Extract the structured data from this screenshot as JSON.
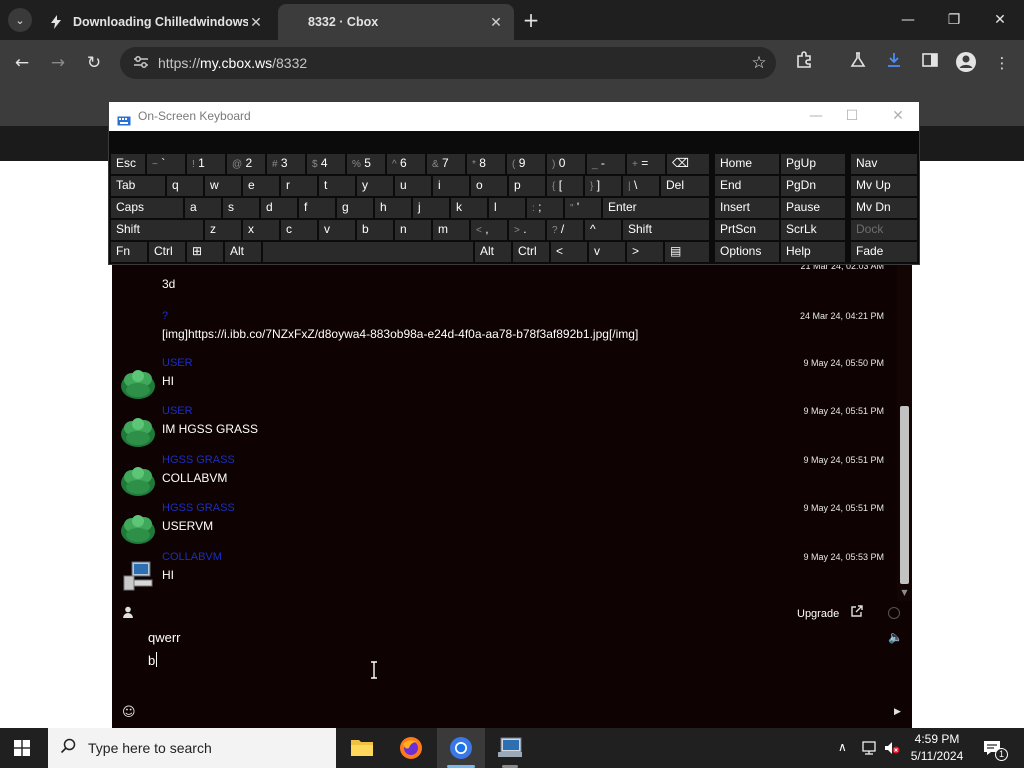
{
  "browser": {
    "tabs": [
      {
        "title": "Downloading Chilledwindows.zip",
        "active": false
      },
      {
        "title": "8332 · Cbox",
        "active": true
      }
    ],
    "url_prefix": "https://",
    "url_host": "my.cbox.ws",
    "url_path": "/8332",
    "colors": {
      "chrome": "#3c3c3c",
      "tabbar": "#1f1f1f",
      "download_active": "#4c8df6"
    }
  },
  "osk": {
    "title": "On-Screen Keyboard",
    "rows": [
      [
        {
          "s": "",
          "m": "Esc"
        },
        {
          "s": "~",
          "m": "`"
        },
        {
          "s": "!",
          "m": "1"
        },
        {
          "s": "@",
          "m": "2"
        },
        {
          "s": "#",
          "m": "3"
        },
        {
          "s": "$",
          "m": "4"
        },
        {
          "s": "%",
          "m": "5"
        },
        {
          "s": "^",
          "m": "6"
        },
        {
          "s": "&",
          "m": "7"
        },
        {
          "s": "*",
          "m": "8"
        },
        {
          "s": "(",
          "m": "9"
        },
        {
          "s": ")",
          "m": "0"
        },
        {
          "s": "_",
          "m": "-"
        },
        {
          "s": "+",
          "m": "="
        },
        {
          "s": "",
          "m": "⌫"
        }
      ],
      [
        {
          "s": "",
          "m": "Tab"
        },
        {
          "s": "",
          "m": "q"
        },
        {
          "s": "",
          "m": "w"
        },
        {
          "s": "",
          "m": "e"
        },
        {
          "s": "",
          "m": "r"
        },
        {
          "s": "",
          "m": "t"
        },
        {
          "s": "",
          "m": "y"
        },
        {
          "s": "",
          "m": "u"
        },
        {
          "s": "",
          "m": "i"
        },
        {
          "s": "",
          "m": "o"
        },
        {
          "s": "",
          "m": "p"
        },
        {
          "s": "{",
          "m": "["
        },
        {
          "s": "}",
          "m": "]"
        },
        {
          "s": "|",
          "m": "\\"
        },
        {
          "s": "",
          "m": "Del"
        }
      ],
      [
        {
          "s": "",
          "m": "Caps"
        },
        {
          "s": "",
          "m": "a"
        },
        {
          "s": "",
          "m": "s"
        },
        {
          "s": "",
          "m": "d"
        },
        {
          "s": "",
          "m": "f"
        },
        {
          "s": "",
          "m": "g"
        },
        {
          "s": "",
          "m": "h"
        },
        {
          "s": "",
          "m": "j"
        },
        {
          "s": "",
          "m": "k"
        },
        {
          "s": "",
          "m": "l"
        },
        {
          "s": ":",
          "m": ";"
        },
        {
          "s": "\"",
          "m": "'"
        },
        {
          "s": "",
          "m": "Enter"
        }
      ],
      [
        {
          "s": "",
          "m": "Shift"
        },
        {
          "s": "",
          "m": "z"
        },
        {
          "s": "",
          "m": "x"
        },
        {
          "s": "",
          "m": "c"
        },
        {
          "s": "",
          "m": "v"
        },
        {
          "s": "",
          "m": "b"
        },
        {
          "s": "",
          "m": "n"
        },
        {
          "s": "",
          "m": "m"
        },
        {
          "s": "<",
          "m": ","
        },
        {
          "s": ">",
          "m": "."
        },
        {
          "s": "?",
          "m": "/"
        },
        {
          "s": "",
          "m": "^"
        },
        {
          "s": "",
          "m": "Shift"
        }
      ],
      [
        {
          "s": "",
          "m": "Fn"
        },
        {
          "s": "",
          "m": "Ctrl"
        },
        {
          "s": "",
          "m": "⊞"
        },
        {
          "s": "",
          "m": "Alt"
        },
        {
          "s": "",
          "m": ""
        },
        {
          "s": "",
          "m": "Alt"
        },
        {
          "s": "",
          "m": "Ctrl"
        },
        {
          "s": "",
          "m": "<"
        },
        {
          "s": "",
          "m": "v"
        },
        {
          "s": "",
          "m": ">"
        },
        {
          "s": "",
          "m": "▤"
        }
      ]
    ],
    "nav_keys": [
      [
        "Home",
        "PgUp",
        "Nav"
      ],
      [
        "End",
        "PgDn",
        "Mv Up"
      ],
      [
        "Insert",
        "Pause",
        "Mv Dn"
      ],
      [
        "PrtScn",
        "ScrLk",
        "Dock"
      ],
      [
        "Options",
        "Help",
        "Fade"
      ]
    ]
  },
  "chat": {
    "messages": [
      {
        "user": "",
        "text": "3d",
        "time": "21 Mar 24, 02:03 AM",
        "avatar": "none"
      },
      {
        "user": "?",
        "text": "[img]https://i.ibb.co/7NZxFxZ/d8oywa4-883ob98a-e24d-4f0a-aa78-b78f3af892b1.jpg[/img]",
        "time": "24 Mar 24, 04:21 PM",
        "avatar": "none"
      },
      {
        "user": "USER",
        "text": "HI",
        "time": "9 May 24, 05:50 PM",
        "avatar": "grass"
      },
      {
        "user": "USER",
        "text": "IM HGSS GRASS",
        "time": "9 May 24, 05:51 PM",
        "avatar": "grass"
      },
      {
        "user": "HGSS GRASS",
        "text": "COLLABVM",
        "time": "9 May 24, 05:51 PM",
        "avatar": "grass"
      },
      {
        "user": "HGSS GRASS",
        "text": "USERVM",
        "time": "9 May 24, 05:51 PM",
        "avatar": "grass"
      },
      {
        "user": "COLLABVM",
        "text": "HI",
        "time": "9 May 24, 05:53 PM",
        "avatar": "computer"
      }
    ],
    "upgrade_label": "Upgrade",
    "input_lines": [
      "qwerr",
      "b"
    ]
  },
  "taskbar": {
    "search_placeholder": "Type here to search",
    "time": "4:59 PM",
    "date": "5/11/2024",
    "notification_count": "1"
  }
}
